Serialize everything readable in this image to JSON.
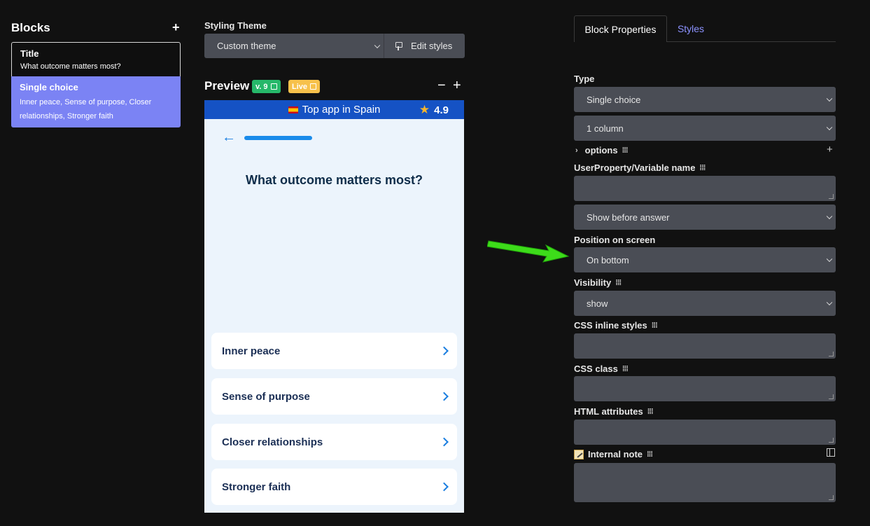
{
  "blocks": {
    "title": "Blocks",
    "add_label": "+",
    "items": [
      {
        "name": "Title",
        "desc": "What outcome matters most?"
      },
      {
        "name": "Single choice",
        "desc": "Inner peace, Sense of purpose, Closer relationships, Stronger faith"
      }
    ]
  },
  "theme": {
    "label": "Styling Theme",
    "value": "Custom theme",
    "edit_label": "Edit styles"
  },
  "preview": {
    "label": "Preview",
    "version_badge": "v. 9",
    "live_badge": "Live",
    "zoom_out": "−",
    "zoom_in": "+",
    "banner_text": "Top app in Spain",
    "rating": "4.9",
    "question": "What outcome matters most?",
    "options": [
      "Inner peace",
      "Sense of purpose",
      "Closer relationships",
      "Stronger faith"
    ]
  },
  "tabs": {
    "active": "Block Properties",
    "inactive": "Styles"
  },
  "properties": {
    "type_label": "Type",
    "type_value": "Single choice",
    "columns_value": "1 column",
    "options_label": "options",
    "options_add": "+",
    "variable_label": "UserProperty/Variable name",
    "show_value": "Show before answer",
    "position_label": "Position on screen",
    "position_value": "On bottom",
    "visibility_label": "Visibility",
    "visibility_value": "show",
    "css_inline_label": "CSS inline styles",
    "css_class_label": "CSS class",
    "html_attr_label": "HTML attributes",
    "note_label": "Internal note"
  },
  "colors": {
    "accent": "#7b83f4",
    "annotation_arrow": "#3ddc1a",
    "banner": "#1552c4"
  }
}
